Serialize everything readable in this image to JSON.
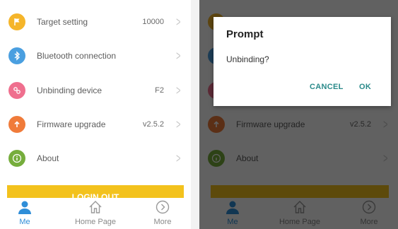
{
  "settings": {
    "items": [
      {
        "label": "Target setting",
        "value": "10000",
        "icon": "flag-icon",
        "color": "#f5b52a"
      },
      {
        "label": "Bluetooth connection",
        "value": "",
        "icon": "bluetooth-icon",
        "color": "#4a9fe0"
      },
      {
        "label": "Unbinding device",
        "value": "F2",
        "icon": "unlink-icon",
        "color": "#ef6f8e"
      },
      {
        "label": "Firmware upgrade",
        "value": "v2.5.2",
        "icon": "upload-icon",
        "color": "#f07b3a"
      },
      {
        "label": "About",
        "value": "",
        "icon": "info-icon",
        "color": "#76ad3c"
      }
    ],
    "login_button": "LOGIN OUT"
  },
  "tabbar": {
    "tabs": [
      {
        "label": "Me",
        "icon": "person-icon",
        "active": true
      },
      {
        "label": "Home Page",
        "icon": "home-icon",
        "active": false
      },
      {
        "label": "More",
        "icon": "more-icon",
        "active": false
      }
    ],
    "active_color": "#2f8ed8"
  },
  "dialog": {
    "title": "Prompt",
    "message": "Unbinding?",
    "cancel_label": "CANCEL",
    "ok_label": "OK"
  }
}
